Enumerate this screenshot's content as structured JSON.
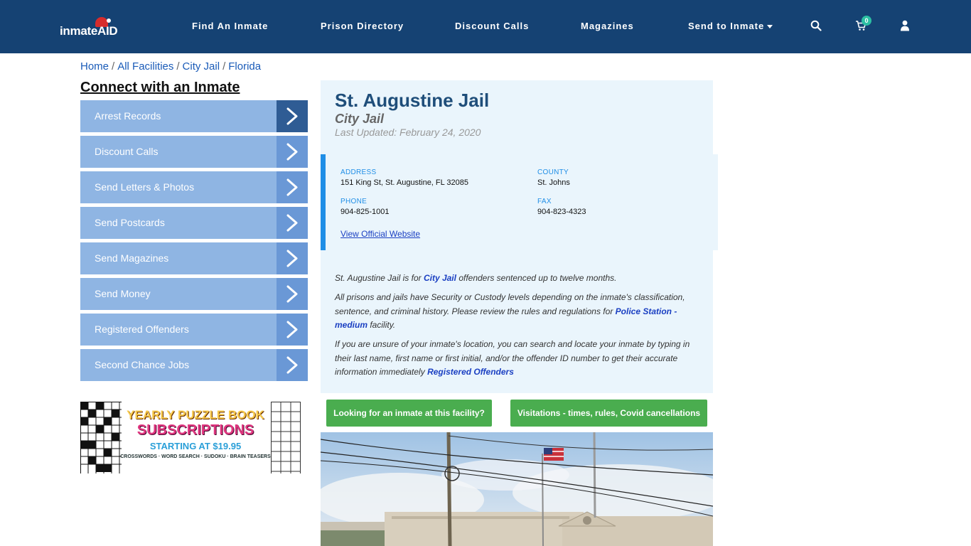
{
  "header": {
    "logo_text": "inmateAID",
    "nav": [
      {
        "label": "Find An Inmate"
      },
      {
        "label": "Prison Directory"
      },
      {
        "label": "Discount Calls"
      },
      {
        "label": "Magazines"
      },
      {
        "label": "Send to Inmate"
      }
    ],
    "cart_count": "0",
    "icons": [
      "search-icon",
      "cart-icon",
      "user-icon"
    ]
  },
  "breadcrumb": [
    "Home",
    "All Facilities",
    "City Jail",
    "Florida"
  ],
  "sidebar": {
    "title": "Connect with an Inmate",
    "items": [
      {
        "label": "Arrest Records"
      },
      {
        "label": "Discount Calls"
      },
      {
        "label": "Send Letters & Photos"
      },
      {
        "label": "Send Postcards"
      },
      {
        "label": "Send Magazines"
      },
      {
        "label": "Send Money"
      },
      {
        "label": "Registered Offenders"
      },
      {
        "label": "Second Chance Jobs"
      }
    ],
    "ad": {
      "line1": "YEARLY PUZZLE BOOK",
      "line2": "SUBSCRIPTIONS",
      "line3": "STARTING AT $19.95",
      "line4": "CROSSWORDS · WORD SEARCH · SUDOKU · BRAIN TEASERS"
    }
  },
  "facility": {
    "name": "St. Augustine Jail",
    "type": "City Jail",
    "updated": "Last Updated: February 24, 2020",
    "address_label": "ADDRESS",
    "address": "151 King St, St. Augustine, FL 32085",
    "county_label": "COUNTY",
    "county": "St. Johns",
    "phone_label": "PHONE",
    "phone": "904-825-1001",
    "fax_label": "FAX",
    "fax": "904-823-4323",
    "website_link": "View Official Website"
  },
  "description": {
    "p1_pre": "St. Augustine Jail is for ",
    "p1_link": "City Jail",
    "p1_post": " offenders sentenced up to twelve months.",
    "p2_pre": "All prisons and jails have Security or Custody levels depending on the inmate's classification, sentence, and criminal history. Please review the rules and regulations for ",
    "p2_link": "Police Station - medium",
    "p2_post": " facility.",
    "p3_pre": "If you are unsure of your inmate's location, you can search and locate your inmate by typing in their last name, first name or first initial, and/or the offender ID number to get their accurate information immediately ",
    "p3_link": "Registered Offenders"
  },
  "buttons": {
    "inmate_search": "Looking for an inmate at this facility?",
    "visitations": "Visitations - times, rules, Covid cancellations"
  },
  "colors": {
    "header_bg": "#154273",
    "sidebar_item": "#8fb5e3",
    "sidebar_arrow": "#6a98d6",
    "sidebar_arrow_active": "#2f5c94",
    "accent_green": "#4aad4f",
    "panel_bg": "#eaf5fc"
  }
}
